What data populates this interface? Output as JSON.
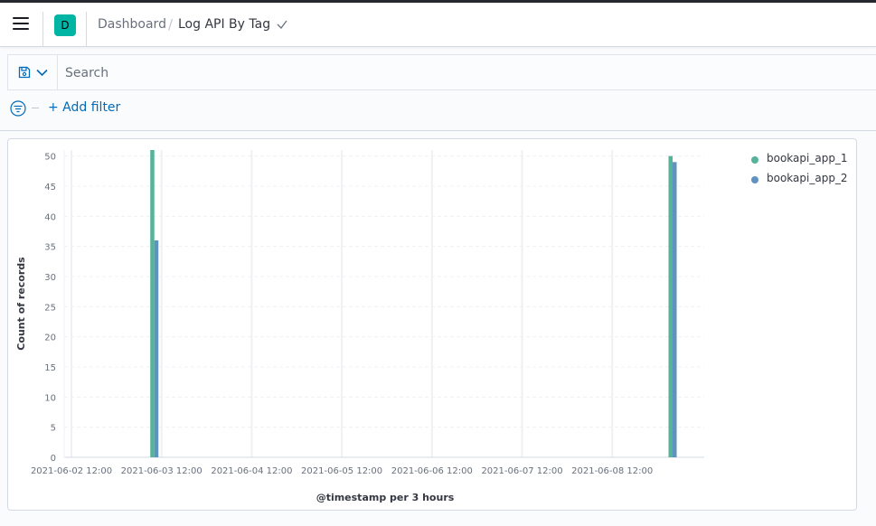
{
  "header": {
    "space_initial": "D",
    "breadcrumbs": [
      "Dashboard",
      "Log API By Tag"
    ],
    "breadcrumb_separator": "/"
  },
  "search": {
    "placeholder": "Search",
    "value": ""
  },
  "filters": {
    "add_filter_label": "+ Add filter"
  },
  "colors": {
    "accent": "#006bb8",
    "series_1": "#54b399",
    "series_2": "#6092c0",
    "space": "#01b5a5"
  },
  "chart_data": {
    "type": "bar",
    "xlabel": "@timestamp per 3 hours",
    "ylabel": "Count of records",
    "ylim": [
      0,
      51
    ],
    "yticks": [
      0,
      5,
      10,
      15,
      20,
      25,
      30,
      35,
      40,
      45,
      50
    ],
    "xticks": [
      "2021-06-02 12:00",
      "2021-06-03 12:00",
      "2021-06-04 12:00",
      "2021-06-05 12:00",
      "2021-06-06 12:00",
      "2021-06-07 12:00",
      "2021-06-08 12:00"
    ],
    "x": [
      "2021-06-03 09:00",
      "2021-06-09 03:00"
    ],
    "series": [
      {
        "name": "bookapi_app_1",
        "values": [
          51,
          50
        ]
      },
      {
        "name": "bookapi_app_2",
        "values": [
          36,
          49
        ]
      }
    ],
    "legend_position": "right",
    "grid": true
  }
}
